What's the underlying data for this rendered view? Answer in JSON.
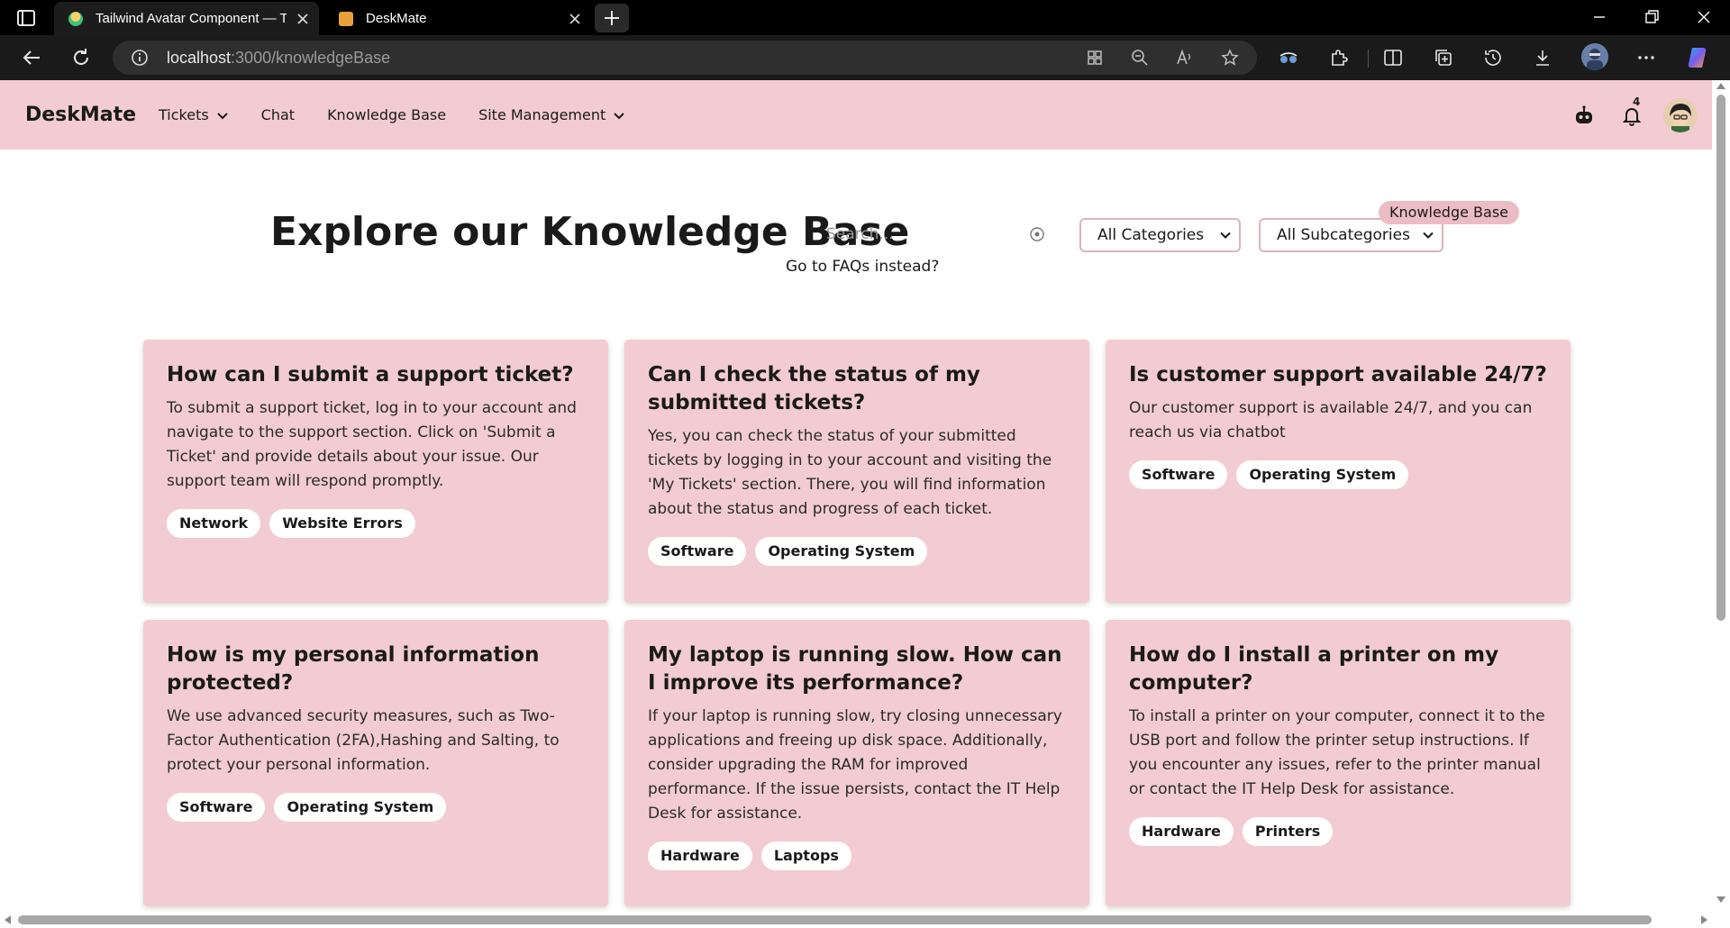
{
  "browser": {
    "tabs": [
      {
        "title": "Tailwind Avatar Component — Ta",
        "active": false
      },
      {
        "title": "DeskMate",
        "active": true
      }
    ],
    "url_host": "localhost",
    "url_path": ":3000/knowledgeBase"
  },
  "header": {
    "brand": "DeskMate",
    "nav": [
      {
        "label": "Tickets",
        "has_dropdown": true
      },
      {
        "label": "Chat",
        "has_dropdown": false
      },
      {
        "label": "Knowledge Base",
        "has_dropdown": false
      },
      {
        "label": "Site Management",
        "has_dropdown": true
      }
    ],
    "notification_count": "4",
    "icons": [
      "chatbot-icon",
      "bell-icon",
      "avatar"
    ]
  },
  "main": {
    "title": "Explore our Knowledge Base",
    "search_placeholder": "Search...",
    "faq_link": "Go to FAQs instead?",
    "category_select": "All Categories",
    "subcategory_select": "All Subcategories",
    "tooltip": "Knowledge Base"
  },
  "cards": [
    {
      "title": "How can I submit a support ticket?",
      "body": "To submit a support ticket, log in to your account and navigate to the support section. Click on 'Submit a Ticket' and provide details about your issue. Our support team will respond promptly.",
      "tags": [
        "Network",
        "Website Errors"
      ]
    },
    {
      "title": "Can I check the status of my submitted tickets?",
      "body": "Yes, you can check the status of your submitted tickets by logging in to your account and visiting the 'My Tickets' section. There, you will find information about the status and progress of each ticket.",
      "tags": [
        "Software",
        "Operating System"
      ]
    },
    {
      "title": "Is customer support available 24/7?",
      "body": "Our customer support is available 24/7, and you can reach us via chatbot",
      "tags": [
        "Software",
        "Operating System"
      ]
    },
    {
      "title": "How is my personal information protected?",
      "body": "We use advanced security measures, such as Two-Factor Authentication (2FA),Hashing and Salting, to protect your personal information.",
      "tags": [
        "Software",
        "Operating System"
      ]
    },
    {
      "title": "My laptop is running slow. How can I improve its performance?",
      "body": "If your laptop is running slow, try closing unnecessary applications and freeing up disk space. Additionally, consider upgrading the RAM for improved performance. If the issue persists, contact the IT Help Desk for assistance.",
      "tags": [
        "Hardware",
        "Laptops"
      ]
    },
    {
      "title": "How do I install a printer on my computer?",
      "body": "To install a printer on your computer, connect it to the USB port and follow the printer setup instructions. If you encounter any issues, refer to the printer manual or contact the IT Help Desk for assistance.",
      "tags": [
        "Hardware",
        "Printers"
      ]
    }
  ],
  "colors": {
    "header_bg": "#f2ccd2",
    "card_bg": "#f2ccd2",
    "tag_bg": "#ffffff",
    "select_border": "#e0b2b8",
    "tooltip_bg": "#ecbcc4"
  }
}
